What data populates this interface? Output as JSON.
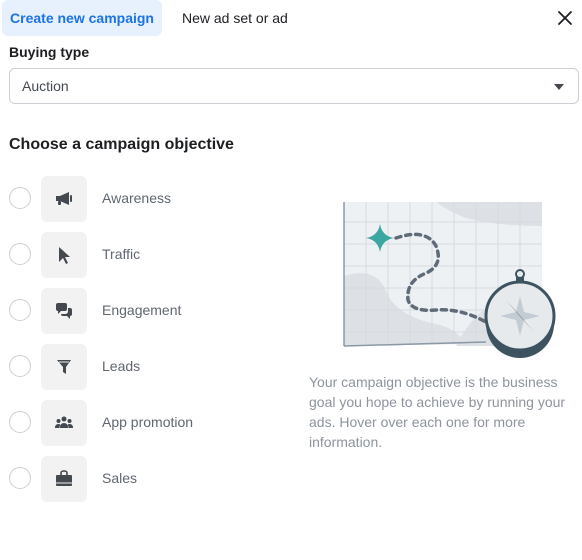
{
  "tabs": [
    {
      "label": "Create new campaign",
      "active": true
    },
    {
      "label": "New ad set or ad",
      "active": false
    }
  ],
  "close_icon": "close-icon",
  "buying_type": {
    "label": "Buying type",
    "value": "Auction"
  },
  "objective_heading": "Choose a campaign objective",
  "objectives": [
    {
      "label": "Awareness",
      "icon": "megaphone-icon",
      "selected": false
    },
    {
      "label": "Traffic",
      "icon": "cursor-icon",
      "selected": false
    },
    {
      "label": "Engagement",
      "icon": "chat-bubbles-icon",
      "selected": false
    },
    {
      "label": "Leads",
      "icon": "funnel-icon",
      "selected": false
    },
    {
      "label": "App promotion",
      "icon": "people-icon",
      "selected": false
    },
    {
      "label": "Sales",
      "icon": "shopping-bag-icon",
      "selected": false
    }
  ],
  "illustration": "map-and-compass-illustration",
  "description": "Your campaign objective is the business goal you hope to achieve by running your ads. Hover over each one for more information.",
  "colors": {
    "accent": "#1b74e4",
    "active_tab_bg": "#e7f0fd",
    "map_star": "#3aa8a0",
    "compass": "#3e5360"
  }
}
